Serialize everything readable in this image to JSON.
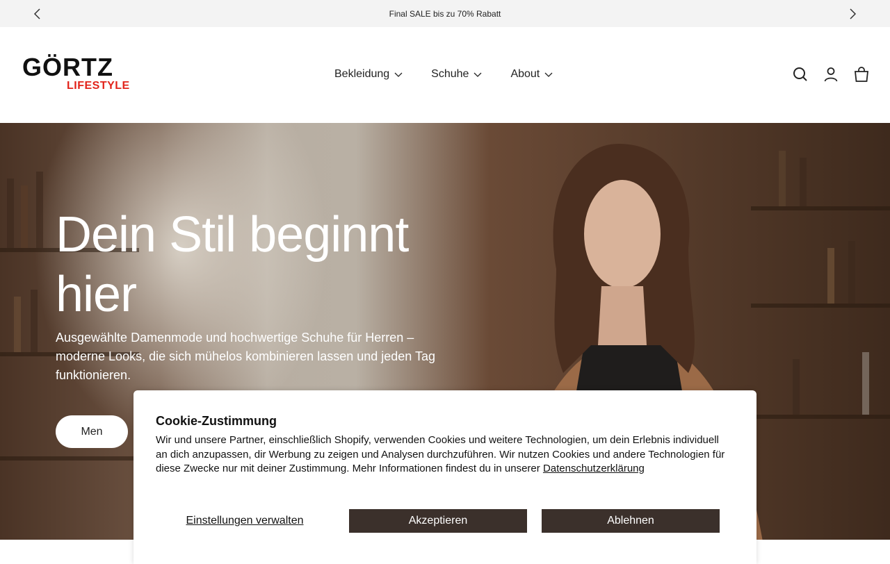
{
  "announcement": {
    "text": "Final SALE bis zu 70% Rabatt"
  },
  "header": {
    "logo": {
      "brand": "GÖRTZ",
      "sub": "LIFESTYLE"
    },
    "nav": [
      {
        "label": "Bekleidung"
      },
      {
        "label": "Schuhe"
      },
      {
        "label": "About"
      }
    ],
    "icons": [
      "search-icon",
      "account-icon",
      "cart-icon"
    ]
  },
  "hero": {
    "title": "Dein Stil beginnt hier",
    "subtitle": "Ausgewählte Damenmode und hochwertige Schuhe für Herren – moderne Looks, die sich mühelos kombinieren lassen und jeden Tag funktionieren.",
    "button_label": "Men"
  },
  "cookie": {
    "title": "Cookie-Zustimmung",
    "body": "Wir und unsere Partner, einschließlich Shopify, verwenden Cookies und weitere Technologien, um dein Erlebnis individuell an dich anzupassen, dir Werbung zu zeigen und Analysen durchzuführen. Wir nutzen Cookies und andere Technologien für diese Zwecke nur mit deiner Zustimmung. Mehr Informationen findest du in unserer",
    "privacy_link": "Datenschutzerklärung",
    "settings_label": "Einstellungen verwalten",
    "accept_label": "Akzeptieren",
    "decline_label": "Ablehnen"
  },
  "colors": {
    "announce_bg": "#f3f3f3",
    "brand_red": "#e2231a",
    "button_dark": "#3b302b"
  }
}
